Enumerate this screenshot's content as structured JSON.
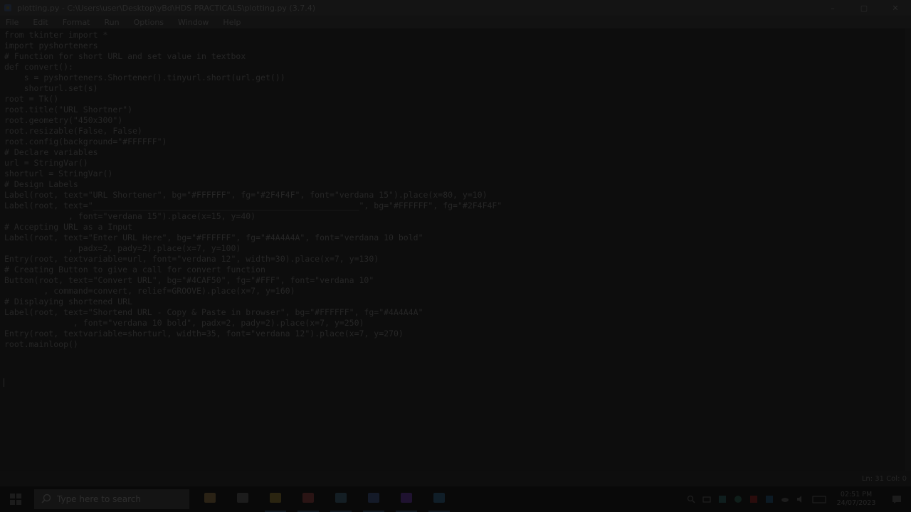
{
  "window": {
    "title": "plotting.py - C:\\Users\\user\\Desktop\\yBd\\HDS PRACTICALS\\plotting.py (3.7.4)",
    "icon": "python-file-icon",
    "controls": {
      "minimize": "–",
      "maximize": "▢",
      "close": "✕"
    }
  },
  "menu": [
    "File",
    "Edit",
    "Format",
    "Run",
    "Options",
    "Window",
    "Help"
  ],
  "editor": {
    "lines": [
      "from tkinter import *",
      "import pyshorteners",
      "# Function for short URL and set value in textbox",
      "def convert():",
      "    s = pyshorteners.Shortener().tinyurl.short(url.get())",
      "    shorturl.set(s)",
      "root = Tk()",
      "root.title(\"URL Shortner\")",
      "root.geometry(\"450x300\")",
      "root.resizable(False, False)",
      "root.config(background=\"#FFFFFF\")",
      "# Declare variables",
      "url = StringVar()",
      "shorturl = StringVar()",
      "# Design Labels",
      "Label(root, text=\"URL Shortener\", bg=\"#FFFFFF\", fg=\"#2F4F4F\", font=\"verdana 15\").place(x=80, y=10)",
      "Label(root, text=\"______________________________________________________\", bg=\"#FFFFFF\", fg=\"#2F4F4F\"",
      "             , font=\"verdana 15\").place(x=15, y=40)",
      "# Accepting URL as a Input",
      "Label(root, text=\"Enter URL Here\", bg=\"#FFFFFF\", fg=\"#4A4A4A\", font=\"verdana 10 bold\"",
      "             , padx=2, pady=2).place(x=7, y=100)",
      "Entry(root, textvariable=url, font=\"verdana 12\", width=30).place(x=7, y=130)",
      "# Creating Button to give a call for convert function",
      "Button(root, text=\"Convert URL\", bg=\"#4CAF50\", fg=\"#FFF\", font=\"verdana 10\"",
      "        , command=convert, relief=GROOVE).place(x=7, y=160)",
      "# Displaying shortened URL",
      "Label(root, text=\"Shortend URL - Copy & Paste in browser\", bg=\"#FFFFFF\", fg=\"#4A4A4A\"",
      "              , font=\"verdana 10 bold\", padx=2, pady=2).place(x=7, y=250)",
      "Entry(root, textvariable=shorturl, width=35, font=\"verdana 12\").place(x=7, y=270)",
      "root.mainloop()",
      ""
    ]
  },
  "status": {
    "position": "Ln: 31   Col: 0"
  },
  "taskbar": {
    "start_icon": "windows-start-icon",
    "search_placeholder": "Type here to search",
    "apps": [
      {
        "name": "taskbar-app-people",
        "icon": "people-icon"
      },
      {
        "name": "taskbar-app-taskview",
        "icon": "task-view-icon"
      },
      {
        "name": "taskbar-app-explorer",
        "icon": "folder-icon"
      },
      {
        "name": "taskbar-app-chrome",
        "icon": "chrome-icon"
      },
      {
        "name": "taskbar-app-store",
        "icon": "store-icon"
      },
      {
        "name": "taskbar-app-python",
        "icon": "python-icon"
      },
      {
        "name": "taskbar-app-media",
        "icon": "media-icon"
      },
      {
        "name": "taskbar-app-idle",
        "icon": "idle-icon"
      }
    ],
    "clock": {
      "time": "02:51 PM",
      "date": "24/07/2023"
    }
  },
  "colors": {
    "keyword": "#FF7700",
    "comment": "#DD0000",
    "string": "#00AA00",
    "builtin": "#900090"
  }
}
